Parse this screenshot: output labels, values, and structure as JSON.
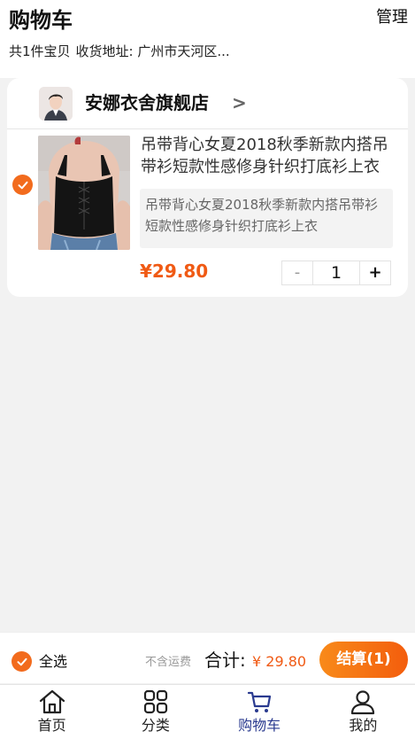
{
  "header": {
    "title": "购物车",
    "manage_label": "管理",
    "item_count_text": "共1件宝贝",
    "address_text": "收货地址: 广州市天河区..."
  },
  "shop": {
    "name": "安娜衣舍旗舰店",
    "arrow": ">"
  },
  "item": {
    "title": "吊带背心女夏2018秋季新款内搭吊带衫短款性感修身针织打底衫上衣",
    "sku": "吊带背心女夏2018秋季新款内搭吊带衫短款性感修身针织打底衫上衣",
    "price": "¥29.80",
    "quantity": "1",
    "minus_label": "-",
    "plus_label": "+",
    "checked": true
  },
  "checkout": {
    "select_all_label": "全选",
    "shipping_note": "不含运费",
    "total_label": "合计:",
    "total_value": "¥ 29.80",
    "button_label": "结算(1)"
  },
  "tabbar": {
    "items": [
      {
        "label": "首页",
        "icon": "home-icon"
      },
      {
        "label": "分类",
        "icon": "grid-icon"
      },
      {
        "label": "购物车",
        "icon": "cart-icon",
        "active": true
      },
      {
        "label": "我的",
        "icon": "user-icon"
      }
    ]
  },
  "colors": {
    "accent": "#f26b1d",
    "price": "#f05a14",
    "active_tab": "#2a3a8f",
    "background": "#f2f2f2"
  }
}
